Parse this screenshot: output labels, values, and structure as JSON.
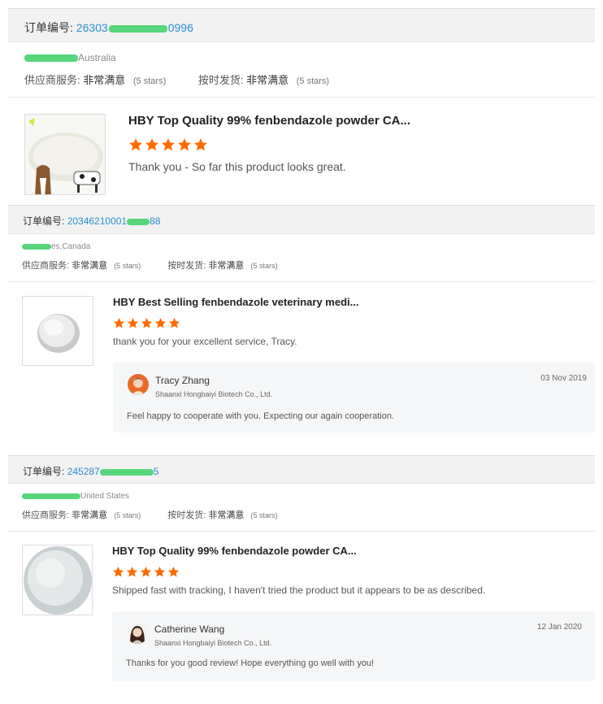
{
  "reviews": [
    {
      "order_label": "订单编号:",
      "order_number_visible": "26303",
      "order_number_tail": "0996",
      "location": "Australia",
      "supplier_label": "供应商服务:",
      "supplier_value": "非常满意",
      "supplier_stars": "(5 stars)",
      "delivery_label": "按时发货:",
      "delivery_value": "非常满意",
      "delivery_stars": "(5 stars)",
      "product_title": "HBY Top Quality 99% fenbendazole powder CA...",
      "rating": 5,
      "comment": "Thank you - So far this product looks great."
    },
    {
      "order_label": "订单编号:",
      "order_number_visible": "20346210001",
      "order_number_tail": "88",
      "location": "es,Canada",
      "supplier_label": "供应商服务:",
      "supplier_value": "非常满意",
      "supplier_stars": "(5 stars)",
      "delivery_label": "按时发货:",
      "delivery_value": "非常满意",
      "delivery_stars": "(5 stars)",
      "product_title": "HBY Best Selling fenbendazole veterinary medi...",
      "rating": 5,
      "comment": "thank you for your excellent service, Tracy.",
      "reply": {
        "name": "Tracy Zhang",
        "company": "Shaanxi Hongbaiyi Biotech Co., Ltd.",
        "date": "03 Nov 2019",
        "text": "Feel happy to cooperate with you. Expecting our again cooperation."
      }
    },
    {
      "order_label": "订单编号:",
      "order_number_visible": "245287",
      "order_number_tail": "5",
      "location": "United States",
      "supplier_label": "供应商服务:",
      "supplier_value": "非常满意",
      "supplier_stars": "(5 stars)",
      "delivery_label": "按时发货:",
      "delivery_value": "非常满意",
      "delivery_stars": "(5 stars)",
      "product_title": "HBY Top Quality 99% fenbendazole powder CA...",
      "rating": 5,
      "comment": "Shipped fast with tracking, I haven't tried the product but it appears to be as described.",
      "reply": {
        "name": "Catherine Wang",
        "company": "Shaanxi Hongbaiyi Biotech Co., Ltd.",
        "date": "12 Jan 2020",
        "text": "Thanks for you good review! Hope everything go well with you!"
      }
    }
  ],
  "colors": {
    "order_number": "#2a8fd4",
    "star": "#ff6a00",
    "mask": "#57d57a",
    "bar_bg": "#f2f2f2",
    "reply_bg": "#f5f6f7"
  },
  "icons": {
    "star": "star-icon",
    "avatar": "avatar"
  }
}
